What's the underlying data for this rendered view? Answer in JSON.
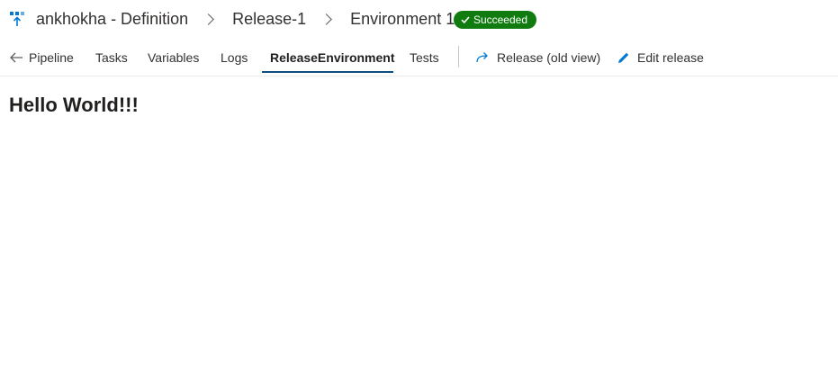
{
  "header": {
    "logo_icon": "release-pipeline-icon",
    "breadcrumbs": [
      "ankhokha - Definition",
      "Release-1",
      "Environment 1"
    ],
    "environment_dropdown_icon": "chevron-down-icon",
    "status": {
      "label": "Succeeded",
      "icon": "checkmark-icon",
      "color": "#107c10"
    }
  },
  "tabs": {
    "back_label": "Pipeline",
    "back_icon": "arrow-left-icon",
    "items": [
      "Tasks",
      "Variables",
      "Logs",
      "ReleaseEnvironment",
      "Tests"
    ],
    "active": "ReleaseEnvironment"
  },
  "actions": {
    "release_old_view": {
      "label": "Release (old view)",
      "icon": "redo-arrow-icon"
    },
    "edit_release": {
      "label": "Edit release",
      "icon": "pencil-icon"
    }
  },
  "content": {
    "heading": "Hello World!!!"
  }
}
